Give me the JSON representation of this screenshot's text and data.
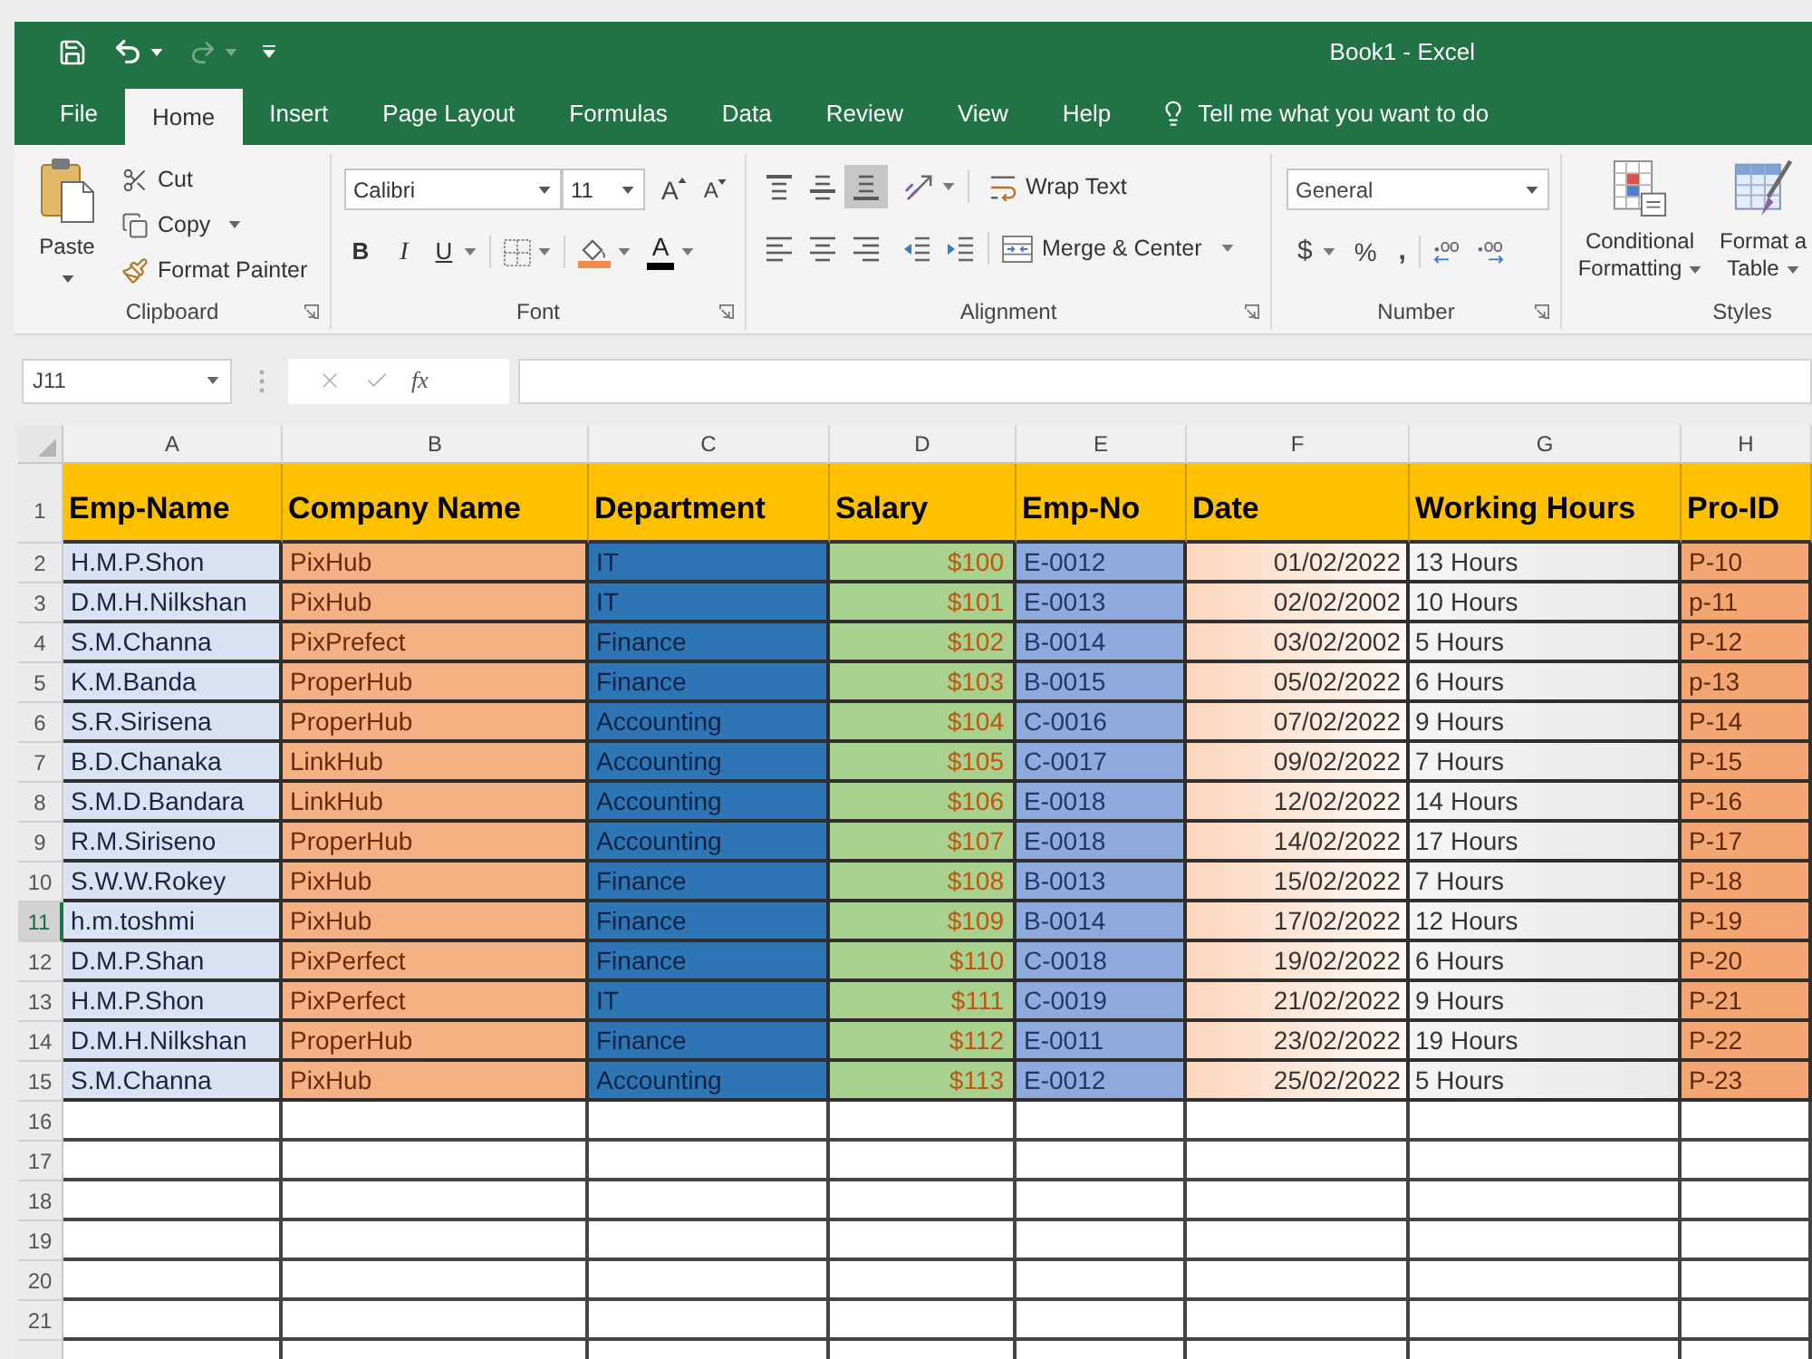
{
  "title_bar": {
    "quick_access": [
      {
        "kind": "save",
        "disabled": false
      },
      {
        "kind": "undo",
        "disabled": false
      },
      {
        "kind": "redo",
        "disabled": true
      }
    ],
    "title": "Book1 - Excel"
  },
  "tabs": [
    {
      "label": "File",
      "selected": false
    },
    {
      "label": "Home",
      "selected": true
    },
    {
      "label": "Insert",
      "selected": false
    },
    {
      "label": "Page Layout",
      "selected": false
    },
    {
      "label": "Formulas",
      "selected": false
    },
    {
      "label": "Data",
      "selected": false
    },
    {
      "label": "Review",
      "selected": false
    },
    {
      "label": "View",
      "selected": false
    },
    {
      "label": "Help",
      "selected": false
    }
  ],
  "tell_me": "Tell me what you want to do",
  "ribbon": {
    "clipboard": {
      "paste": "Paste",
      "cut": "Cut",
      "copy": "Copy",
      "format_painter": "Format Painter",
      "group_label": "Clipboard"
    },
    "font": {
      "font_name": "Calibri",
      "font_size": "11",
      "grow": "A",
      "shrink": "A",
      "bold": "B",
      "italic": "I",
      "underline": "U",
      "font_color": "A",
      "group_label": "Font"
    },
    "alignment": {
      "vertical": [
        {
          "kind": "top",
          "selected": false
        },
        {
          "kind": "middle",
          "selected": false
        },
        {
          "kind": "bottom",
          "selected": true
        }
      ],
      "horizontal": [
        {
          "kind": "left",
          "selected": false
        },
        {
          "kind": "center",
          "selected": false
        },
        {
          "kind": "right",
          "selected": false
        }
      ],
      "wrap_text": "Wrap Text",
      "merge_center": "Merge & Center",
      "group_label": "Alignment"
    },
    "number": {
      "format": "General",
      "currency": "$",
      "percent": "%",
      "comma": ",",
      "group_label": "Number"
    },
    "styles": {
      "conditional_formatting": [
        "Conditional",
        "Formatting"
      ],
      "format_as_table": [
        "Format a",
        "Table"
      ],
      "group_label": "Styles"
    }
  },
  "formula_bar": {
    "name_box": "J11",
    "function_label": "fx"
  },
  "sheet": {
    "columns": [
      "A",
      "B",
      "C",
      "D",
      "E",
      "F",
      "G",
      "H"
    ],
    "rows": [
      {
        "number": "1",
        "kind": "header",
        "selected": false,
        "cells": [
          "Emp-Name",
          "Company Name",
          "Department",
          "Salary",
          "Emp-No",
          "Date",
          "Working Hours",
          "Pro-ID"
        ]
      },
      {
        "number": "2",
        "kind": "data",
        "selected": false,
        "cells": [
          "H.M.P.Shon",
          "PixHub",
          "IT",
          "$100",
          "E-0012",
          "01/02/2022",
          "13 Hours",
          "P-10"
        ]
      },
      {
        "number": "3",
        "kind": "data",
        "selected": false,
        "cells": [
          "D.M.H.Nilkshan",
          "PixHub",
          "IT",
          "$101",
          "E-0013",
          "02/02/2002",
          "10 Hours",
          "p-11"
        ]
      },
      {
        "number": "4",
        "kind": "data",
        "selected": false,
        "cells": [
          "S.M.Channa",
          "PixPrefect",
          "Finance",
          "$102",
          "B-0014",
          "03/02/2002",
          "5 Hours",
          "P-12"
        ]
      },
      {
        "number": "5",
        "kind": "data",
        "selected": false,
        "cells": [
          "K.M.Banda",
          "ProperHub",
          "Finance",
          "$103",
          "B-0015",
          "05/02/2022",
          "6 Hours",
          "p-13"
        ]
      },
      {
        "number": "6",
        "kind": "data",
        "selected": false,
        "cells": [
          "S.R.Sirisena",
          "ProperHub",
          "Accounting",
          "$104",
          "C-0016",
          "07/02/2022",
          "9 Hours",
          "P-14"
        ]
      },
      {
        "number": "7",
        "kind": "data",
        "selected": false,
        "cells": [
          "B.D.Chanaka",
          "LinkHub",
          "Accounting",
          "$105",
          "C-0017",
          "09/02/2022",
          "7 Hours",
          "P-15"
        ]
      },
      {
        "number": "8",
        "kind": "data",
        "selected": false,
        "cells": [
          "S.M.D.Bandara",
          "LinkHub",
          "Accounting",
          "$106",
          "E-0018",
          "12/02/2022",
          "14 Hours",
          "P-16"
        ]
      },
      {
        "number": "9",
        "kind": "data",
        "selected": false,
        "cells": [
          "R.M.Siriseno",
          "ProperHub",
          "Accounting",
          "$107",
          "E-0018",
          "14/02/2022",
          "17 Hours",
          "P-17"
        ]
      },
      {
        "number": "10",
        "kind": "data",
        "selected": false,
        "cells": [
          "S.W.W.Rokey",
          "PixHub",
          "Finance",
          "$108",
          "B-0013",
          "15/02/2022",
          "7 Hours",
          "P-18"
        ]
      },
      {
        "number": "11",
        "kind": "data",
        "selected": true,
        "cells": [
          "h.m.toshmi",
          "PixHub",
          "Finance",
          "$109",
          "B-0014",
          "17/02/2022",
          "12 Hours",
          "P-19"
        ]
      },
      {
        "number": "12",
        "kind": "data",
        "selected": false,
        "cells": [
          "D.M.P.Shan",
          "PixPerfect",
          "Finance",
          "$110",
          "C-0018",
          "19/02/2022",
          "6 Hours",
          "P-20"
        ]
      },
      {
        "number": "13",
        "kind": "data",
        "selected": false,
        "cells": [
          "H.M.P.Shon",
          "PixPerfect",
          "IT",
          "$111",
          "C-0019",
          "21/02/2022",
          "9 Hours",
          "P-21"
        ]
      },
      {
        "number": "14",
        "kind": "data",
        "selected": false,
        "cells": [
          "D.M.H.Nilkshan",
          "ProperHub",
          "Finance",
          "$112",
          "E-0011",
          "23/02/2022",
          "19 Hours",
          "P-22"
        ]
      },
      {
        "number": "15",
        "kind": "data",
        "selected": false,
        "cells": [
          "S.M.Channa",
          "PixHub",
          "Accounting",
          "$113",
          "E-0012",
          "25/02/2022",
          "5 Hours",
          "P-23"
        ]
      },
      {
        "number": "16",
        "kind": "blank",
        "selected": false
      },
      {
        "number": "17",
        "kind": "blank",
        "selected": false
      },
      {
        "number": "18",
        "kind": "blank",
        "selected": false
      },
      {
        "number": "19",
        "kind": "blank",
        "selected": false
      },
      {
        "number": "20",
        "kind": "blank",
        "selected": false
      },
      {
        "number": "21",
        "kind": "blank",
        "selected": false
      }
    ]
  }
}
